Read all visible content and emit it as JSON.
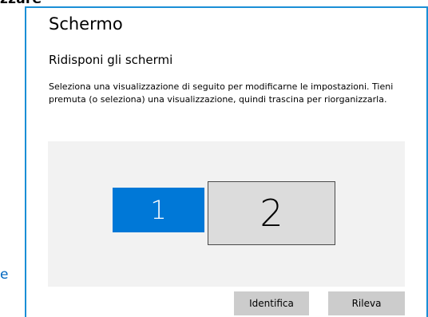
{
  "background": {
    "cut_title": "zzare",
    "cut_link": "e"
  },
  "page": {
    "title": "Schermo",
    "section_title": "Ridisponi gli schermi",
    "description": "Seleziona una visualizzazione di seguito per modificarne le impostazioni. Tieni premuta (o seleziona) una visualizzazione, quindi trascina per riorganizzarla."
  },
  "displays": [
    {
      "label": "1",
      "selected": true,
      "color": "#0078d7"
    },
    {
      "label": "2",
      "selected": false,
      "color": "#dcdcdc"
    }
  ],
  "buttons": {
    "identify_label": "Identifica",
    "detect_label": "Rileva"
  },
  "colors": {
    "accent": "#0078d7",
    "window_border": "#1a8fd6",
    "link": "#0067c0",
    "arrange_background": "#f2f2f2",
    "button_background": "#cccccc"
  }
}
